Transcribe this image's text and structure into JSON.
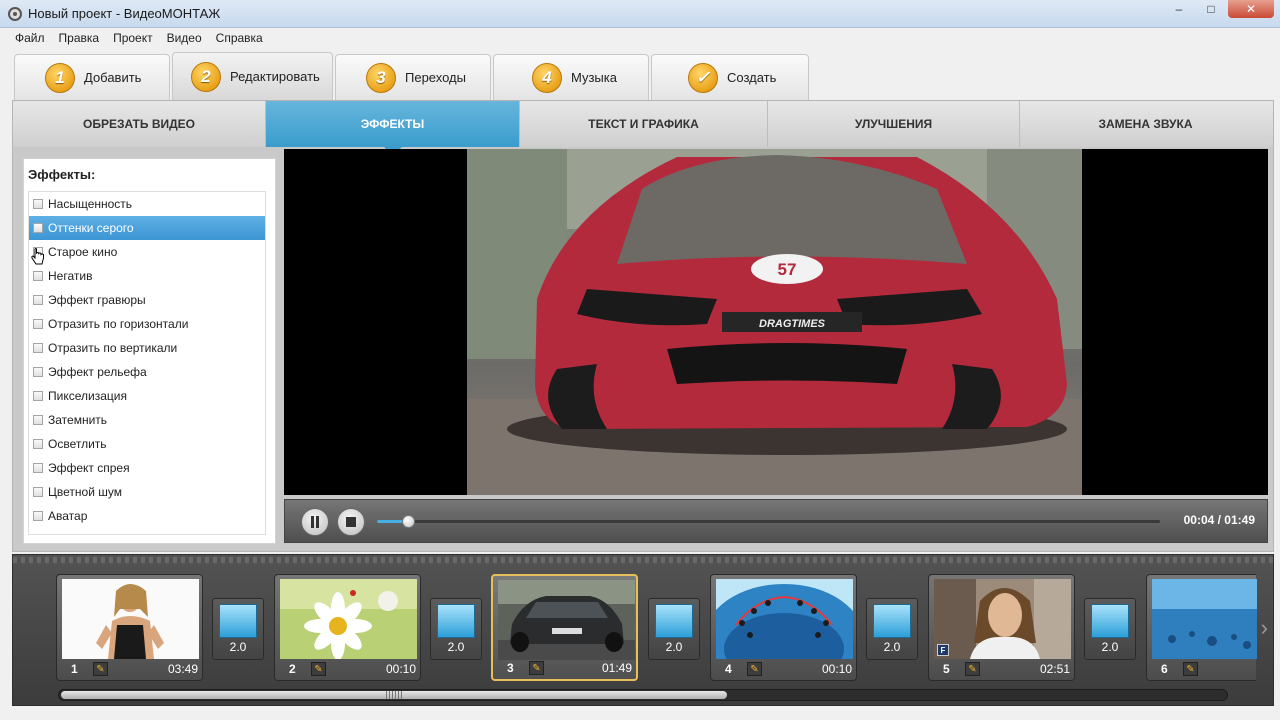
{
  "window": {
    "title": "Новый проект - ВидеоМОНТАЖ",
    "controls": [
      "–",
      "□",
      "✕"
    ]
  },
  "menu": [
    "Файл",
    "Правка",
    "Проект",
    "Видео",
    "Справка"
  ],
  "main_tabs": [
    {
      "num": "1",
      "label": "Добавить"
    },
    {
      "num": "2",
      "label": "Редактировать"
    },
    {
      "num": "3",
      "label": "Переходы"
    },
    {
      "num": "4",
      "label": "Музыка"
    },
    {
      "num": "✓",
      "label": "Создать"
    }
  ],
  "active_main_tab": "Редактировать",
  "sub_tabs": [
    "ОБРЕЗАТЬ ВИДЕО",
    "ЭФФЕКТЫ",
    "ТЕКСТ И ГРАФИКА",
    "УЛУЧШЕНИЯ",
    "ЗАМЕНА ЗВУКА"
  ],
  "active_sub_tab": "ЭФФЕКТЫ",
  "effects": {
    "title": "Эффекты:",
    "items": [
      "Насыщенность",
      "Оттенки серого",
      "Старое кино",
      "Негатив",
      "Эффект гравюры",
      "Отразить по горизонтали",
      "Отразить по вертикали",
      "Эффект рельефа",
      "Пикселизация",
      "Затемнить",
      "Осветлить",
      "Эффект спрея",
      "Цветной шум",
      "Аватар"
    ],
    "selected": "Оттенки серого"
  },
  "preview": {
    "car_number": "57",
    "plate_text": "DRAGTIMES"
  },
  "player": {
    "current": "00:04",
    "total": "01:49",
    "time_text": "00:04 / 01:49",
    "progress": 0.04,
    "accent": "#49aee3"
  },
  "timeline": {
    "clips": [
      {
        "num": "1",
        "duration": "03:49",
        "selected": false
      },
      {
        "num": "2",
        "duration": "00:10",
        "selected": false
      },
      {
        "num": "3",
        "duration": "01:49",
        "selected": true
      },
      {
        "num": "4",
        "duration": "00:10",
        "selected": false
      },
      {
        "num": "5",
        "duration": "02:51",
        "selected": false,
        "badge": "F"
      },
      {
        "num": "6",
        "duration": "",
        "selected": false
      }
    ],
    "transitions": [
      "2.0",
      "2.0",
      "2.0",
      "2.0",
      "2.0"
    ],
    "scroll_fraction": 0.57
  }
}
